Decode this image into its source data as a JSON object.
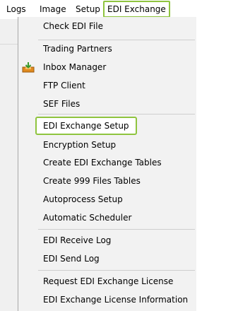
{
  "menubar": {
    "items": [
      {
        "label": "Logs"
      },
      {
        "label": "Image"
      },
      {
        "label": "Setup"
      },
      {
        "label": "EDI Exchange"
      }
    ]
  },
  "dropdown": {
    "items": [
      {
        "label": "Check EDI File"
      },
      {
        "label": "Trading Partners"
      },
      {
        "label": "Inbox Manager",
        "icon": "inbox-tray-icon"
      },
      {
        "label": "FTP Client"
      },
      {
        "label": "SEF Files"
      },
      {
        "label": "EDI Exchange Setup"
      },
      {
        "label": "Encryption Setup"
      },
      {
        "label": "Create EDI Exchange Tables"
      },
      {
        "label": "Create 999 Files Tables"
      },
      {
        "label": "Autoprocess Setup"
      },
      {
        "label": "Automatic Scheduler"
      },
      {
        "label": "EDI Receive Log"
      },
      {
        "label": "EDI Send Log"
      },
      {
        "label": "Request EDI Exchange License"
      },
      {
        "label": "EDI Exchange License Information"
      }
    ]
  },
  "colors": {
    "highlight_border": "#8fc43f",
    "menu_background": "#f2f2f2"
  }
}
